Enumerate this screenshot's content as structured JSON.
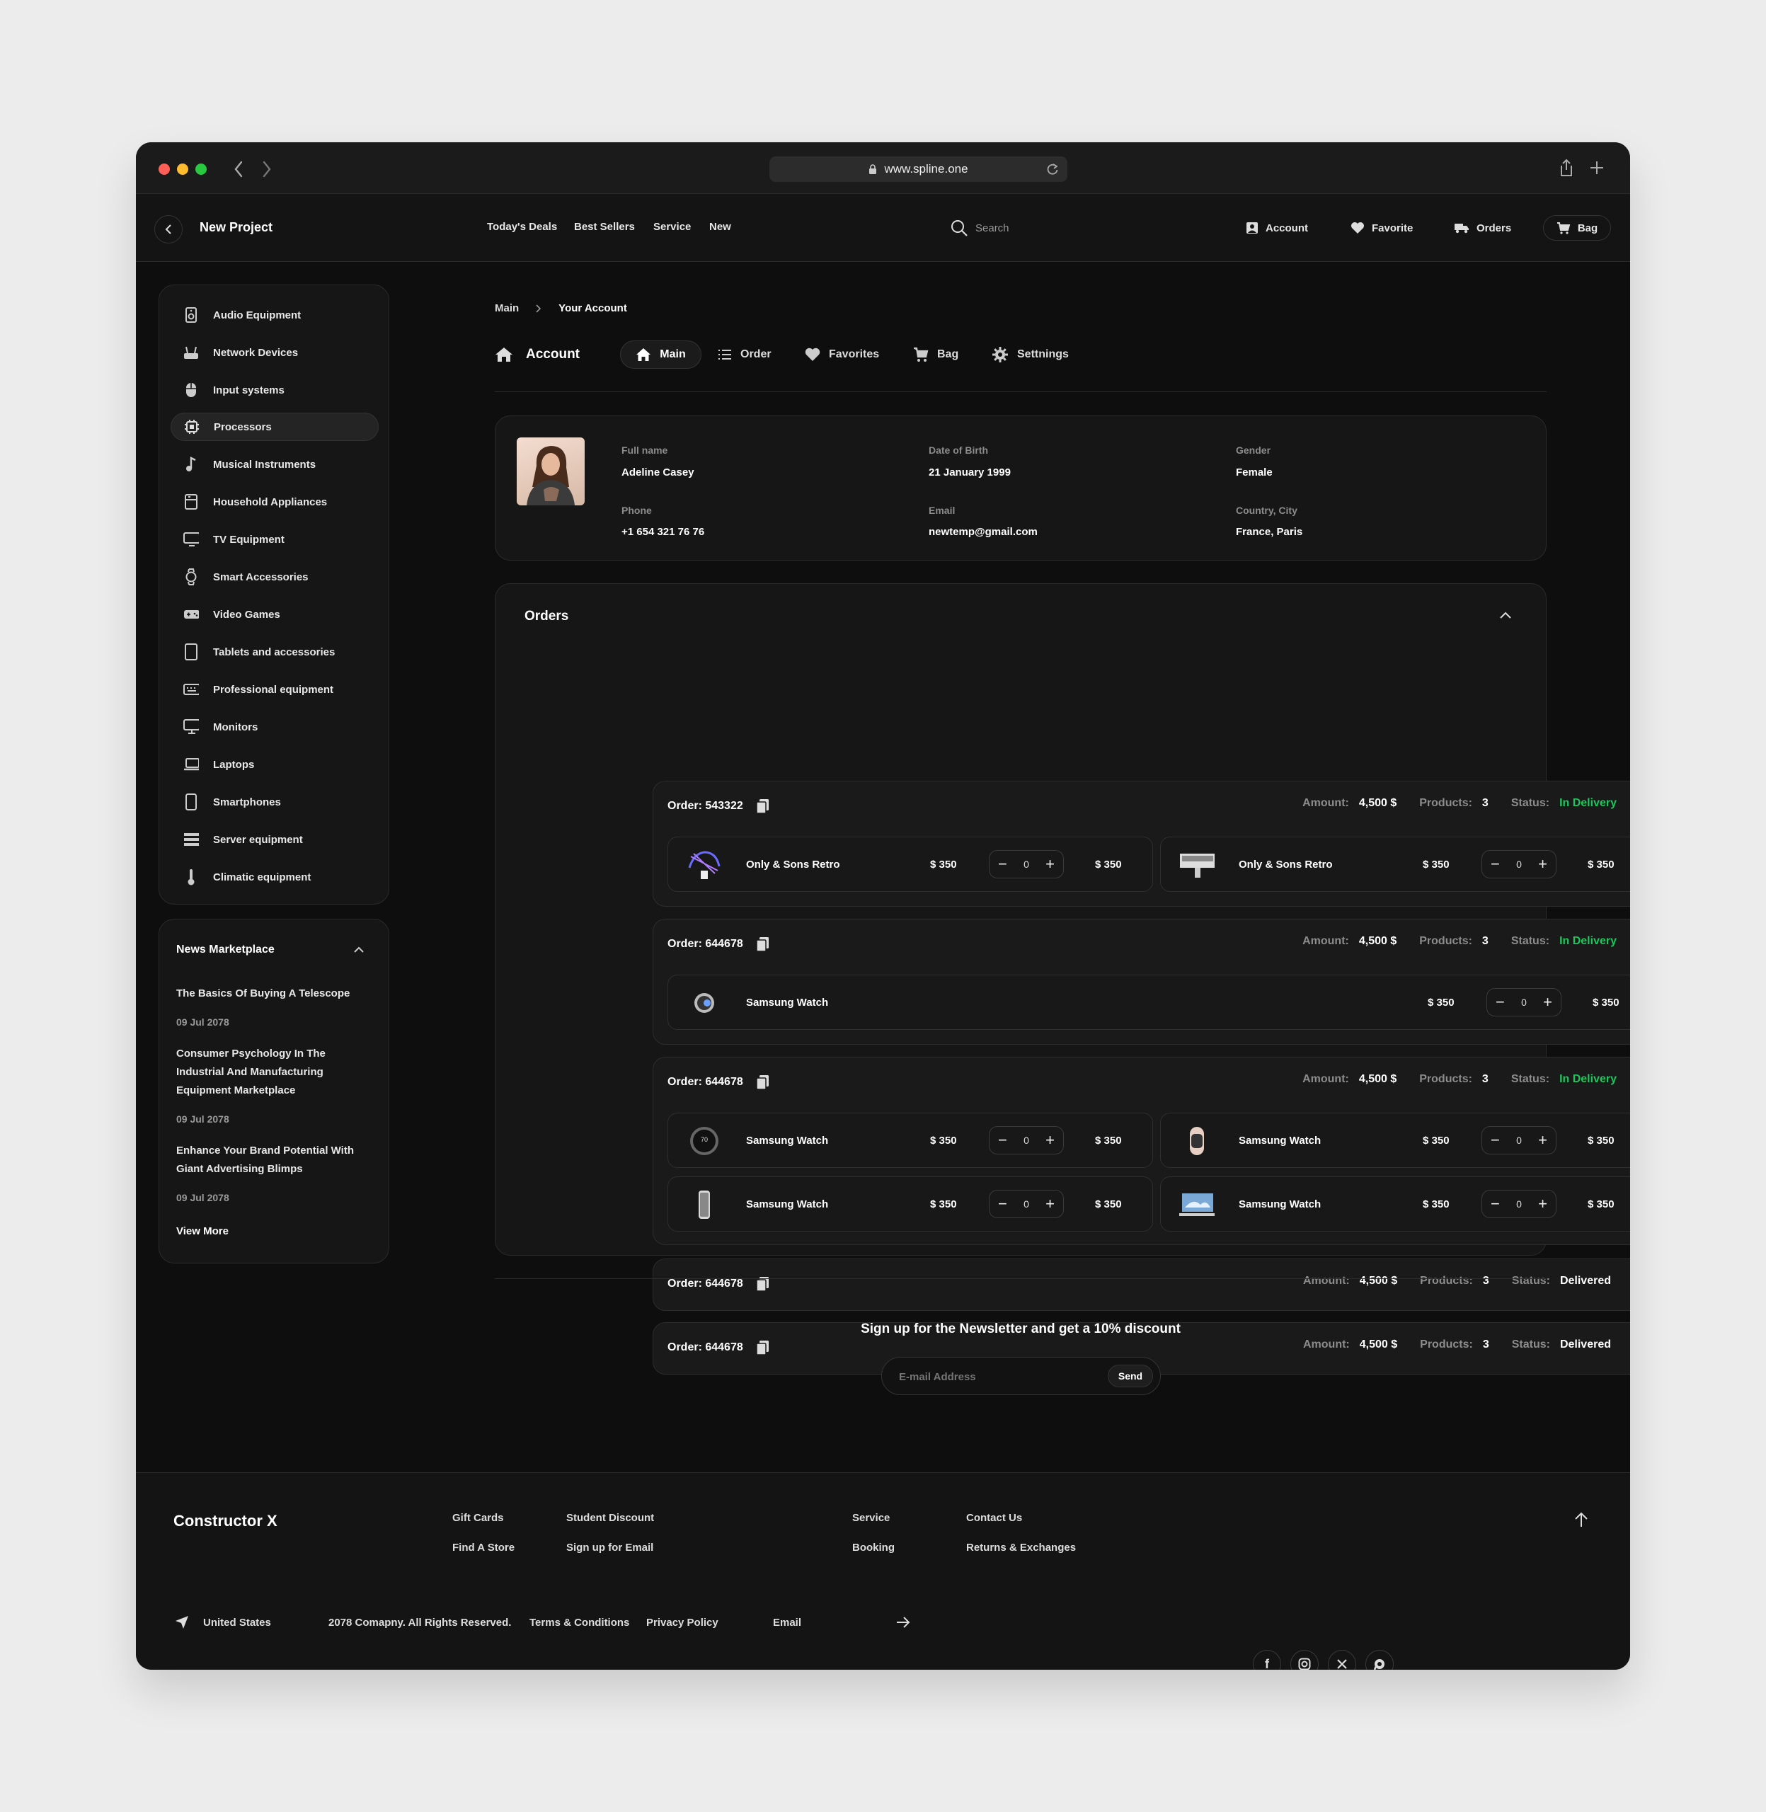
{
  "browser": {
    "url": "www.spline.one"
  },
  "header": {
    "project": "New Project",
    "nav": [
      "Today's Deals",
      "Best Sellers",
      "Service",
      "New"
    ],
    "search_placeholder": "Search",
    "account": "Account",
    "favorite": "Favorite",
    "orders": "Orders",
    "bag": "Bag"
  },
  "sidebar": {
    "categories": [
      "Audio Equipment",
      "Network Devices",
      "Input systems",
      "Processors",
      "Musical Instruments",
      "Household Appliances",
      "TV Equipment",
      "Smart Accessories",
      "Video Games",
      "Tablets and accessories",
      "Professional equipment",
      "Monitors",
      "Laptops",
      "Smartphones",
      "Server equipment",
      "Climatic equipment"
    ],
    "active": "Processors"
  },
  "news": {
    "title": "News Marketplace",
    "items": [
      {
        "title": "The Basics Of Buying A Telescope",
        "date": "09 Jul 2078"
      },
      {
        "title": "Consumer Psychology In The Industrial And Manufacturing Equipment Marketplace",
        "date": "09 Jul 2078"
      },
      {
        "title": "Enhance Your Brand Potential With Giant Advertising Blimps",
        "date": "09 Jul 2078"
      }
    ],
    "view_more": "View More"
  },
  "breadcrumb": [
    "Main",
    "Your Account"
  ],
  "account_tabs": {
    "title": "Account",
    "tabs": [
      "Main",
      "Order",
      "Favorites",
      "Bag",
      "Settnings"
    ]
  },
  "profile": {
    "full_name_label": "Full name",
    "full_name": "Adeline Casey",
    "dob_label": "Date of Birth",
    "dob": "21 January 1999",
    "gender_label": "Gender",
    "gender": "Female",
    "phone_label": "Phone",
    "phone": "+1 654 321 76 76",
    "email_label": "Email",
    "email": "newtemp@gmail.com",
    "city_label": "Country, City",
    "city": "France, Paris"
  },
  "orders": {
    "title": "Orders",
    "labels": {
      "order": "Order:",
      "amount": "Amount:",
      "products": "Products:",
      "status": "Status:"
    },
    "list": [
      {
        "id": "543322",
        "amount": "4,500 $",
        "products": "3",
        "status": "In Delivery",
        "items": [
          {
            "name": "Only & Sons Retro",
            "price": "$ 350",
            "qty": "0",
            "total": "$ 350",
            "icon": "headphones-image"
          },
          {
            "name": "Only & Sons Retro",
            "price": "$ 350",
            "qty": "0",
            "total": "$ 350",
            "icon": "monitor-image"
          }
        ]
      },
      {
        "id": "644678",
        "amount": "4,500 $",
        "products": "3",
        "status": "In Delivery",
        "items": [
          {
            "name": "Samsung Watch",
            "price": "$ 350",
            "qty": "0",
            "total": "$ 350",
            "icon": "watch-image"
          }
        ]
      },
      {
        "id": "644678",
        "amount": "4,500 $",
        "products": "3",
        "status": "In Delivery",
        "items": [
          {
            "name": "Samsung Watch",
            "price": "$ 350",
            "qty": "0",
            "total": "$ 350",
            "icon": "watch-face-image",
            "face": "70"
          },
          {
            "name": "Samsung Watch",
            "price": "$ 350",
            "qty": "0",
            "total": "$ 350",
            "icon": "watch-band-image"
          },
          {
            "name": "Samsung Watch",
            "price": "$ 350",
            "qty": "0",
            "total": "$ 350",
            "icon": "phone-image"
          },
          {
            "name": "Samsung Watch",
            "price": "$ 350",
            "qty": "0",
            "total": "$ 350",
            "icon": "laptop-image"
          }
        ]
      },
      {
        "id": "644678",
        "amount": "4,500 $",
        "products": "3",
        "status": "Delivered",
        "items": []
      },
      {
        "id": "644678",
        "amount": "4,500 $",
        "products": "3",
        "status": "Delivered",
        "items": []
      }
    ]
  },
  "newsletter": {
    "title": "Sign up for the Newsletter and get a 10% discount",
    "placeholder": "E-mail Address",
    "send": "Send"
  },
  "footer": {
    "brand": "Constructor X",
    "links": [
      "Gift Cards",
      "Student Discount",
      "Service",
      "Contact Us",
      "Find A Store",
      "Sign up for Email",
      "Booking",
      "Returns & Exchanges"
    ],
    "country": "United States",
    "copyright": "2078 Comapny. All Rights Reserved.",
    "terms": "Terms & Conditions",
    "privacy": "Privacy Policy",
    "email_label": "Email"
  },
  "colors": {
    "accent_green": "#21c55d",
    "background": "#0e0e0e",
    "panel": "#161616"
  }
}
